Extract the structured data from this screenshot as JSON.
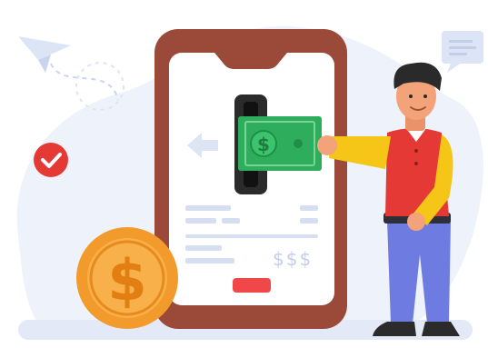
{
  "illustration": {
    "phone_text": {
      "currency_marks": "$$$"
    },
    "banknote_symbol": "$",
    "coin_symbol": "$",
    "icons": [
      "paper-plane-icon",
      "check-badge-icon",
      "chat-bubble-icon",
      "arrow-left-icon",
      "dollar-coin-icon",
      "banknote-icon"
    ],
    "colors": {
      "phone_frame": "#9B4A3A",
      "phone_screen": "#FFFFFF",
      "background_blob": "#EEF2FB",
      "banknote": "#2EAE5C",
      "coin": "#F39A2C",
      "check_badge": "#E53935",
      "shirt": "#E53935",
      "sleeve": "#F5C518",
      "pants": "#6E7BE0",
      "button": "#F04848",
      "placeholder_lines": "#D6DEF2"
    }
  }
}
